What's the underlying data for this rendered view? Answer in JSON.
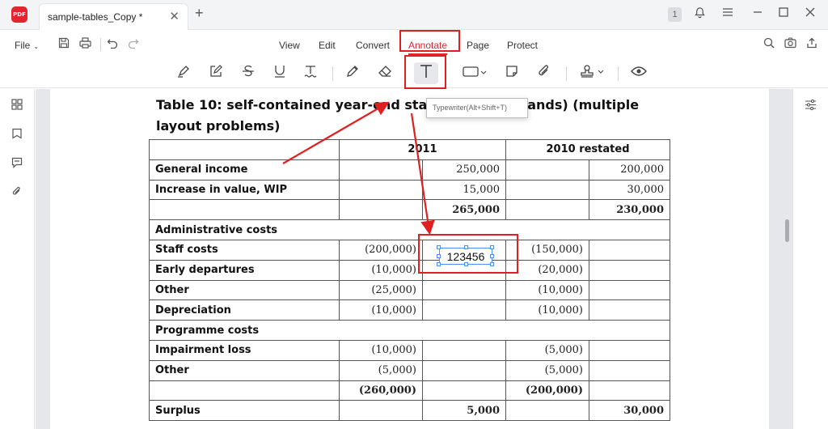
{
  "titlebar": {
    "logo_text": "PDF",
    "tab_title": "sample-tables_Copy *",
    "close_glyph": "✕",
    "add_glyph": "+",
    "badge_count": "1",
    "icons": [
      "bell-icon",
      "hamburger-icon",
      "minimize-icon",
      "maximize-icon",
      "close-icon"
    ]
  },
  "menu": {
    "file_label": "File",
    "items": [
      {
        "label": "View"
      },
      {
        "label": "Edit"
      },
      {
        "label": "Convert"
      },
      {
        "label": "Annotate"
      },
      {
        "label": "Page"
      },
      {
        "label": "Protect"
      }
    ],
    "active_index": 3,
    "accent_color": "#e5242f"
  },
  "toolbar": {
    "tools": [
      "highlighter-icon",
      "note-pen-icon",
      "strikethrough-icon",
      "underline-icon",
      "squiggly-text-icon",
      "pencil-icon",
      "eraser-icon",
      "typewriter-icon",
      "shape-icon",
      "sticky-note-icon",
      "attachment-icon",
      "stamp-icon",
      "eye-icon"
    ],
    "selected": "typewriter-icon",
    "tooltip": "Typewriter(Alt+Shift+T)"
  },
  "document": {
    "title": "Table 10: self-contained year-end statement (thousands) (multiple layout problems)",
    "title_line1": "Table 10: self-contained year-end sta",
    "title_line1_tail": "ousands) (multiple",
    "title_line2": "layout problems)",
    "table": {
      "header_2011": "2011",
      "header_2010": "2010 restated",
      "rows": [
        {
          "label": "General income",
          "c1": "",
          "c2": "250,000",
          "c3": "",
          "c4": "200,000",
          "bold": false
        },
        {
          "label": "Increase in value, WIP",
          "c1": "",
          "c2": "15,000",
          "c3": "",
          "c4": "30,000",
          "bold": false
        },
        {
          "label": "",
          "c1": "",
          "c2": "265,000",
          "c3": "",
          "c4": "230,000",
          "bold": true
        },
        {
          "label": "Administrative costs",
          "span": true
        },
        {
          "label": "Staff costs",
          "c1": "(200,000)",
          "c2": "",
          "c3": "(150,000)",
          "c4": "",
          "bold": false
        },
        {
          "label": "Early departures",
          "c1": "(10,000)",
          "c2": "",
          "c3": "(20,000)",
          "c4": "",
          "bold": false
        },
        {
          "label": "Other",
          "c1": "(25,000)",
          "c2": "",
          "c3": "(10,000)",
          "c4": "",
          "bold": false
        },
        {
          "label": "Depreciation",
          "c1": "(10,000)",
          "c2": "",
          "c3": "(10,000)",
          "c4": "",
          "bold": false
        },
        {
          "label": "Programme costs",
          "span": true
        },
        {
          "label": "Impairment loss",
          "c1": "(10,000)",
          "c2": "",
          "c3": "(5,000)",
          "c4": "",
          "bold": false
        },
        {
          "label": "Other",
          "c1": "(5,000)",
          "c2": "",
          "c3": "(5,000)",
          "c4": "",
          "bold": false
        },
        {
          "label": "",
          "c1": "(260,000)",
          "c2": "",
          "c3": "(200,000)",
          "c4": "",
          "bold": true
        },
        {
          "label": "Surplus",
          "c1": "",
          "c2": "5,000",
          "c3": "",
          "c4": "30,000",
          "bold": true
        }
      ]
    },
    "typewriter_text": "123456"
  }
}
